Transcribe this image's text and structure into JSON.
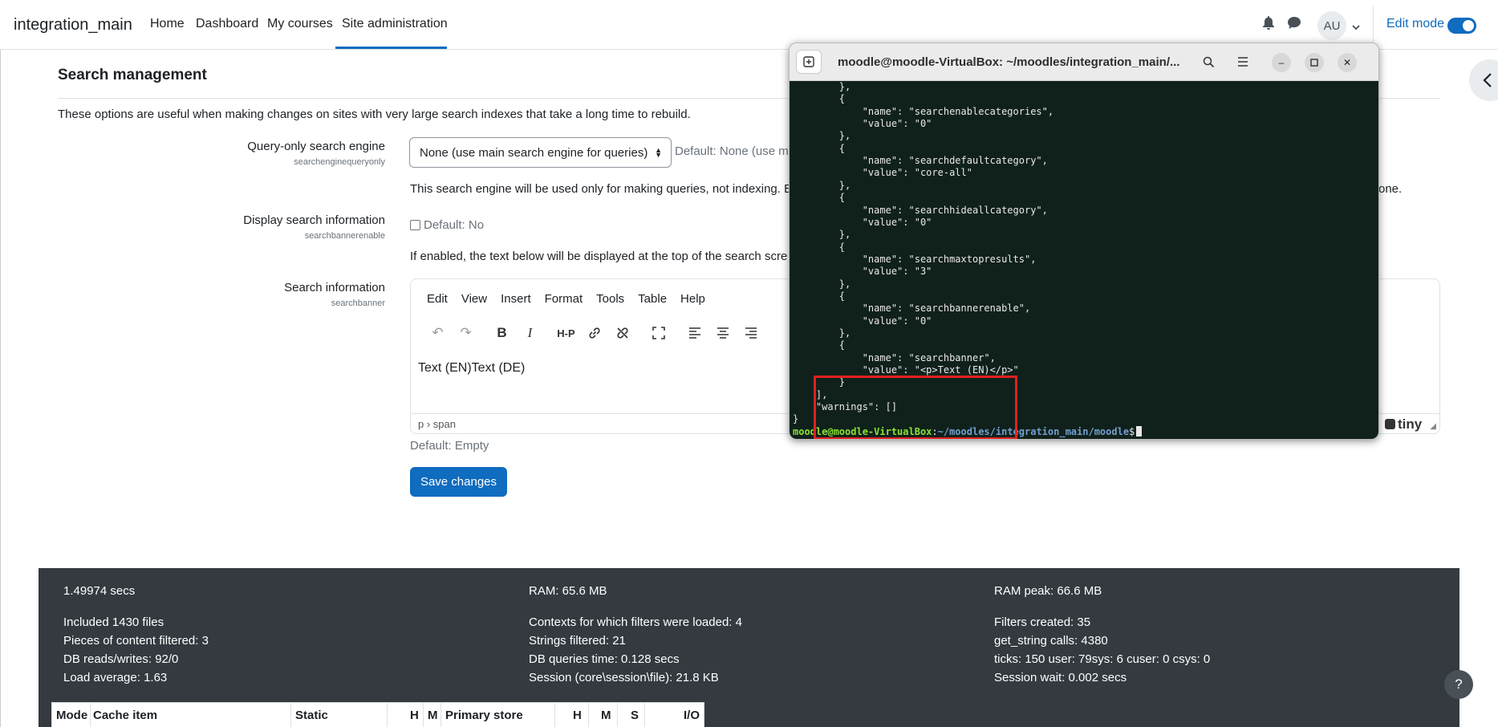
{
  "navbar": {
    "brand": "integration_main",
    "items": [
      "Home",
      "Dashboard",
      "My courses",
      "Site administration"
    ],
    "avatar": "AU",
    "edit_mode": "Edit mode"
  },
  "page": {
    "section_title": "Search management",
    "intro": "These options are useful when making changes on sites with very large search indexes that take a long time to rebuild.",
    "settings": [
      {
        "label": "Query-only search engine",
        "key": "searchenginequeryonly",
        "select_value": "None (use main search engine for queries)",
        "default": "Default: None (use m",
        "description": "This search engine will be used only for making queries, not indexing. E",
        "description_tail": "one."
      },
      {
        "label": "Display search information",
        "key": "searchbannerenable",
        "default": "Default: No",
        "description": "If enabled, the text below will be displayed at the top of the search scre"
      },
      {
        "label": "Search information",
        "key": "searchbanner",
        "default": "Default: Empty"
      }
    ],
    "editor": {
      "menu": [
        "Edit",
        "View",
        "Insert",
        "Format",
        "Tools",
        "Table",
        "Help"
      ],
      "content": "Text (EN)Text (DE)",
      "path": "p › span",
      "brand": "tiny"
    },
    "save_button": "Save changes"
  },
  "footer": {
    "col1": [
      "1.49974 secs",
      "Included 1430 files",
      "Pieces of content filtered: 3",
      "DB reads/writes: 92/0",
      "Load average: 1.63"
    ],
    "col2": [
      "RAM: 65.6 MB",
      "Contexts for which filters were loaded: 4",
      "Strings filtered: 21",
      "DB queries time: 0.128 secs",
      "Session (core\\session\\file): 21.8 KB"
    ],
    "col3": [
      "RAM peak: 66.6 MB",
      "Filters created: 35",
      "get_string calls: 4380",
      "ticks: 150 user: 79sys: 6 cuser: 0 csys: 0",
      "Session wait: 0.002 secs"
    ],
    "table_headers": [
      "Mode",
      "Cache item",
      "Static",
      "H",
      "M",
      "Primary store",
      "H",
      "M",
      "S",
      "I/O"
    ]
  },
  "help": "?",
  "terminal": {
    "title": "moodle@moodle-VirtualBox: ~/moodles/integration_main/...",
    "lines": [
      "        },",
      "        {",
      "            \"name\": \"searchenablecategories\",",
      "            \"value\": \"0\"",
      "        },",
      "        {",
      "            \"name\": \"searchdefaultcategory\",",
      "            \"value\": \"core-all\"",
      "        },",
      "        {",
      "            \"name\": \"searchhideallcategory\",",
      "            \"value\": \"0\"",
      "        },",
      "        {",
      "            \"name\": \"searchmaxtopresults\",",
      "            \"value\": \"3\"",
      "        },",
      "        {",
      "            \"name\": \"searchbannerenable\",",
      "            \"value\": \"0\"",
      "        },",
      "        {",
      "            \"name\": \"searchbanner\",",
      "            \"value\": \"<p>Text (EN)</p>\"",
      "        }",
      "    ],",
      "    \"warnings\": []",
      "}"
    ],
    "prompt_user": "moodle@moodle-VirtualBox",
    "prompt_sep": ":",
    "prompt_path": "~/moodles/integration_main/moodle",
    "prompt_end": "$"
  },
  "colors": {
    "primary": "#0f6cbf",
    "footer_bg": "#343a40",
    "terminal_bg": "#10211b",
    "highlight": "#e02020"
  }
}
